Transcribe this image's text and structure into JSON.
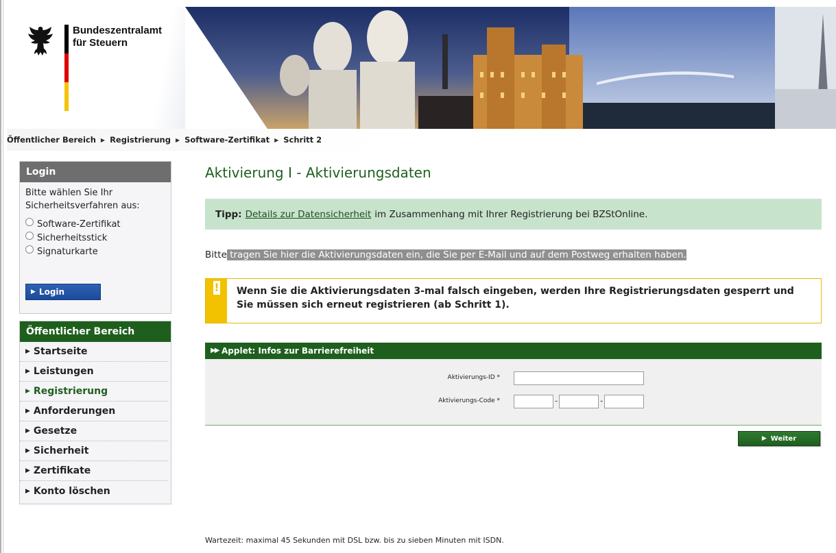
{
  "header": {
    "org_name_line1": "Bundeszentralamt",
    "org_name_line2": "für Steuern"
  },
  "breadcrumb": [
    "Öffentlicher Bereich",
    "Registrierung",
    "Software-Zertifikat",
    "Schritt 2"
  ],
  "login": {
    "title": "Login",
    "intro": "Bitte wählen Sie Ihr Sicherheitsverfahren aus:",
    "options": [
      "Software-Zertifikat",
      "Sicherheitsstick",
      "Signaturkarte"
    ],
    "button": "Login"
  },
  "nav": {
    "title": "Öffentlicher Bereich",
    "items": [
      "Startseite",
      "Leistungen",
      "Registrierung",
      "Anforderungen",
      "Gesetze",
      "Sicherheit",
      "Zertifikate",
      "Konto löschen"
    ],
    "active": "Registrierung"
  },
  "main": {
    "title": "Aktivierung I - Aktivierungsdaten",
    "tip_label": "Tipp:",
    "tip_link": "Details zur Datensicherheit",
    "tip_text": "im Zusammenhang mit Ihrer Registrierung bei BZStOnline.",
    "instr_plain": "Bitte",
    "instr_highlight": " tragen Sie hier die Aktivierungsdaten ein, die Sie per E-Mail und auf dem Postweg erhalten haben.",
    "warning_icon": "!",
    "warning": "Wenn Sie die Aktivierungsdaten 3-mal falsch eingeben, werden Ihre Registrierungsdaten gesperrt und Sie müssen sich erneut registrieren (ab Schritt 1).",
    "applet_link": "Applet: Infos zur Barrierefreiheit",
    "field_id_label": "Aktivierungs-ID *",
    "field_code_label": "Aktivierungs-Code *",
    "id_value": "",
    "code_values": [
      "",
      "",
      ""
    ],
    "next_button": "Weiter",
    "footer_note": "Wartezeit: maximal 45 Sekunden mit DSL bzw. bis zu sieben Minuten mit ISDN."
  },
  "colors": {
    "primary_green": "#1e5f1e",
    "tip_bg": "#c8e3cc",
    "warning_yellow": "#f2c100",
    "login_blue": "#1b4a9a",
    "login_head_gray": "#6e6e6e"
  }
}
